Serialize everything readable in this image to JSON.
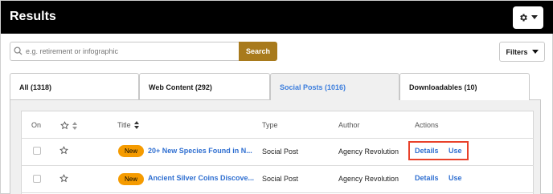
{
  "header": {
    "title": "Results",
    "settings_icon": "gear-icon",
    "settings_caret": "caret-down-icon"
  },
  "search": {
    "placeholder": "e.g. retirement or infographic",
    "button_label": "Search"
  },
  "filters": {
    "label": "Filters",
    "caret_icon": "caret-down-icon"
  },
  "tabs": [
    {
      "label": "All (1318)",
      "active": false
    },
    {
      "label": "Web Content (292)",
      "active": false
    },
    {
      "label": "Social Posts (1016)",
      "active": true
    },
    {
      "label": "Downloadables (10)",
      "active": false
    }
  ],
  "table": {
    "columns": [
      "On",
      "",
      "Title",
      "Type",
      "Author",
      "Actions"
    ],
    "rows": [
      {
        "badge": "New",
        "title": "20+ New Species Found in N...",
        "type": "Social Post",
        "author": "Agency Revolution",
        "actions": [
          "Details",
          "Use"
        ],
        "highlighted": true
      },
      {
        "badge": "New",
        "title": "Ancient Silver Coins Discove...",
        "type": "Social Post",
        "author": "Agency Revolution",
        "actions": [
          "Details",
          "Use"
        ],
        "highlighted": false
      }
    ]
  },
  "colors": {
    "accent_blue": "#2f6fd1",
    "search_button": "#a87a1c",
    "badge": "#f59b00",
    "highlight_box": "#e8412a"
  }
}
